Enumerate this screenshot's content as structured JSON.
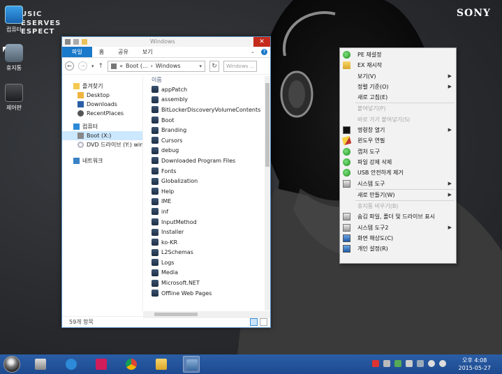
{
  "wallpaper": {
    "brand_lines": [
      "USIC",
      "ESERVES",
      "ESPECT"
    ],
    "logo": "SONY"
  },
  "desktop_icons": [
    {
      "label": "컴퓨터",
      "icon": "computer-icon"
    },
    {
      "label": "휴지통",
      "icon": "recycle-bin-icon"
    },
    {
      "label": "제어판",
      "icon": "control-panel-icon"
    }
  ],
  "explorer": {
    "title": "Windows",
    "tabs": [
      "파일",
      "홈",
      "공유",
      "보기"
    ],
    "address": {
      "prefix": "«",
      "segments": [
        "Boot (...",
        "Windows"
      ]
    },
    "search_placeholder": "Windows ...",
    "nav_pane": [
      {
        "label": "즐겨찾기",
        "icon": "star-icon",
        "level": 0
      },
      {
        "label": "Desktop",
        "icon": "desktop-folder-icon",
        "level": 1
      },
      {
        "label": "Downloads",
        "icon": "downloads-folder-icon",
        "level": 1
      },
      {
        "label": "RecentPlaces",
        "icon": "recent-places-icon",
        "level": 1
      },
      {
        "label": "컴퓨터",
        "icon": "computer-icon",
        "level": 0
      },
      {
        "label": "Boot (X:)",
        "icon": "drive-icon",
        "level": 1,
        "selected": true
      },
      {
        "label": "DVD 드라이브 (Y:) win",
        "icon": "dvd-icon",
        "level": 1
      },
      {
        "label": "네트워크",
        "icon": "network-icon",
        "level": 0
      }
    ],
    "column_header": "이름",
    "files": [
      "appPatch",
      "assembly",
      "BitLockerDiscoveryVolumeContents",
      "Boot",
      "Branding",
      "Cursors",
      "debug",
      "Downloaded Program Files",
      "Fonts",
      "Globalization",
      "Help",
      "IME",
      "inf",
      "InputMethod",
      "Installer",
      "ko-KR",
      "L2Schemas",
      "Logs",
      "Media",
      "Microsoft.NET",
      "Offline Web Pages"
    ],
    "status": "59개 항목"
  },
  "context_menu": [
    {
      "label": "PE 재설정",
      "icon": "refresh-green-icon"
    },
    {
      "label": "EX 재시작",
      "icon": "folder-icon"
    },
    {
      "label": "보기(V)",
      "submenu": true
    },
    {
      "label": "정렬 기준(O)",
      "submenu": true
    },
    {
      "label": "새로 고침(E)"
    },
    {
      "separator": true
    },
    {
      "label": "붙여넣기(P)",
      "disabled": true
    },
    {
      "label": "바로 가기 붙여넣기(S)",
      "disabled": true
    },
    {
      "label": "명령창 열기",
      "icon": "cmd-icon",
      "submenu": true
    },
    {
      "label": "윈도우 연필",
      "icon": "pencil-icon"
    },
    {
      "label": "캡처 도구",
      "icon": "capture-icon"
    },
    {
      "label": "파일 강제 삭제",
      "icon": "delete-icon"
    },
    {
      "label": "USB 안전하게 제거",
      "icon": "usb-icon"
    },
    {
      "label": "시스템 도구",
      "icon": "system-tools-icon",
      "submenu": true
    },
    {
      "separator": true
    },
    {
      "label": "새로 만들기(W)",
      "submenu": true
    },
    {
      "separator": true
    },
    {
      "label": "휴지통 비우기(B)",
      "disabled": true
    },
    {
      "label": "숨김 파일, 폴더 및 드라이브 표시",
      "icon": "hidden-files-icon"
    },
    {
      "label": "시스템 도구2",
      "icon": "system-tools2-icon",
      "submenu": true
    },
    {
      "label": "화면 해상도(C)",
      "icon": "monitor-icon"
    },
    {
      "label": "개인 설정(R)",
      "icon": "personalize-icon"
    }
  ],
  "taskbar": {
    "clock_time": "오후 4:08",
    "clock_date": "2015-05-27"
  }
}
